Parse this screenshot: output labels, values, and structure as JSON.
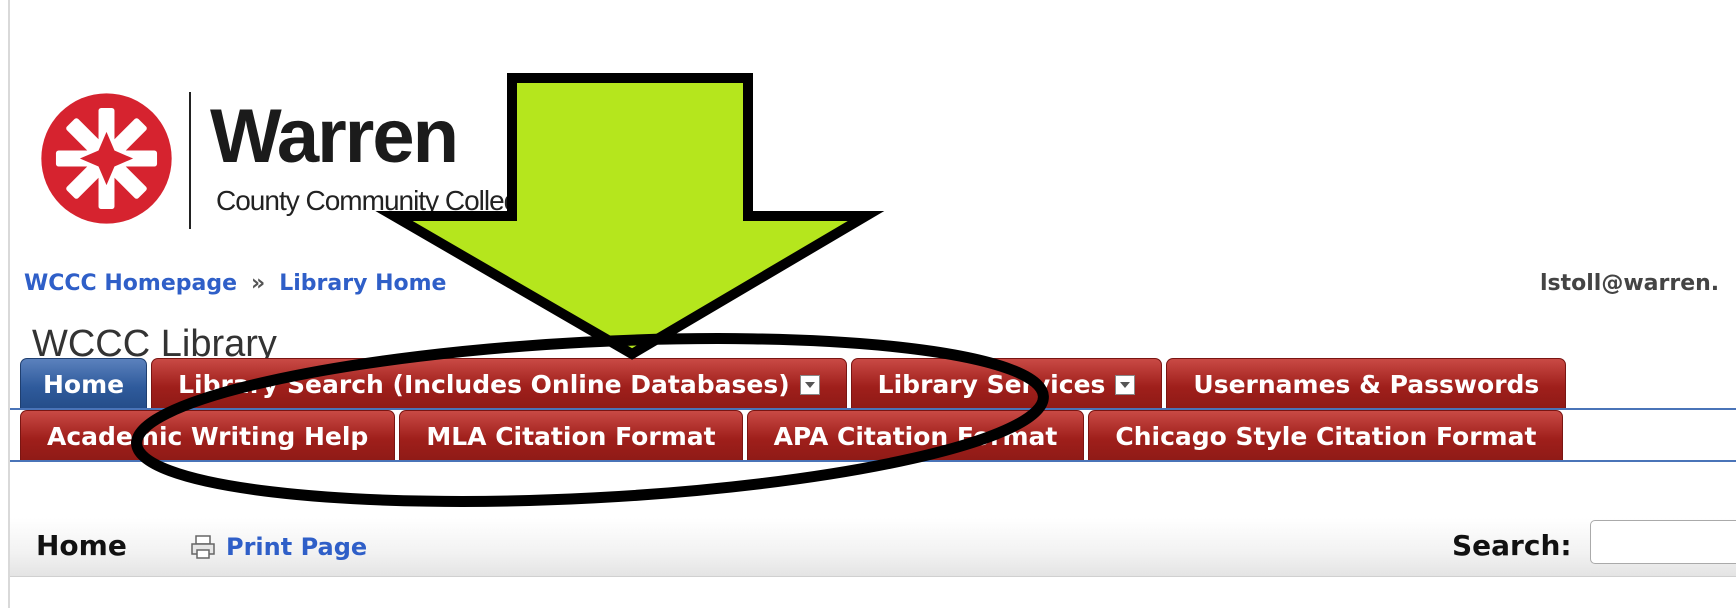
{
  "logo": {
    "name": "Warren",
    "sub": "County Community College"
  },
  "breadcrumb": {
    "items": [
      "WCCC Homepage",
      "Library Home"
    ],
    "separator": "»"
  },
  "user_email": "lstoll@warren.",
  "page_title": "WCCC Library",
  "tabs_row1": [
    {
      "label": "Home",
      "dropdown": false
    },
    {
      "label": "Library Search (Includes Online Databases)",
      "dropdown": true
    },
    {
      "label": "Library Services",
      "dropdown": true
    },
    {
      "label": "Usernames & Passwords",
      "dropdown": false
    }
  ],
  "tabs_row2": [
    {
      "label": "Academic Writing Help"
    },
    {
      "label": "MLA Citation Format"
    },
    {
      "label": "APA Citation Format"
    },
    {
      "label": "Chicago Style Citation Format"
    }
  ],
  "page_bar": {
    "current": "Home",
    "print_label": "Print Page",
    "search_label": "Search:",
    "search_value": ""
  },
  "colors": {
    "tab_red": "#9f1f1b",
    "tab_blue": "#2f5b9c",
    "link_blue": "#2f5fc8",
    "arrow_green": "#b5e61d",
    "logo_red": "#d6232f"
  }
}
